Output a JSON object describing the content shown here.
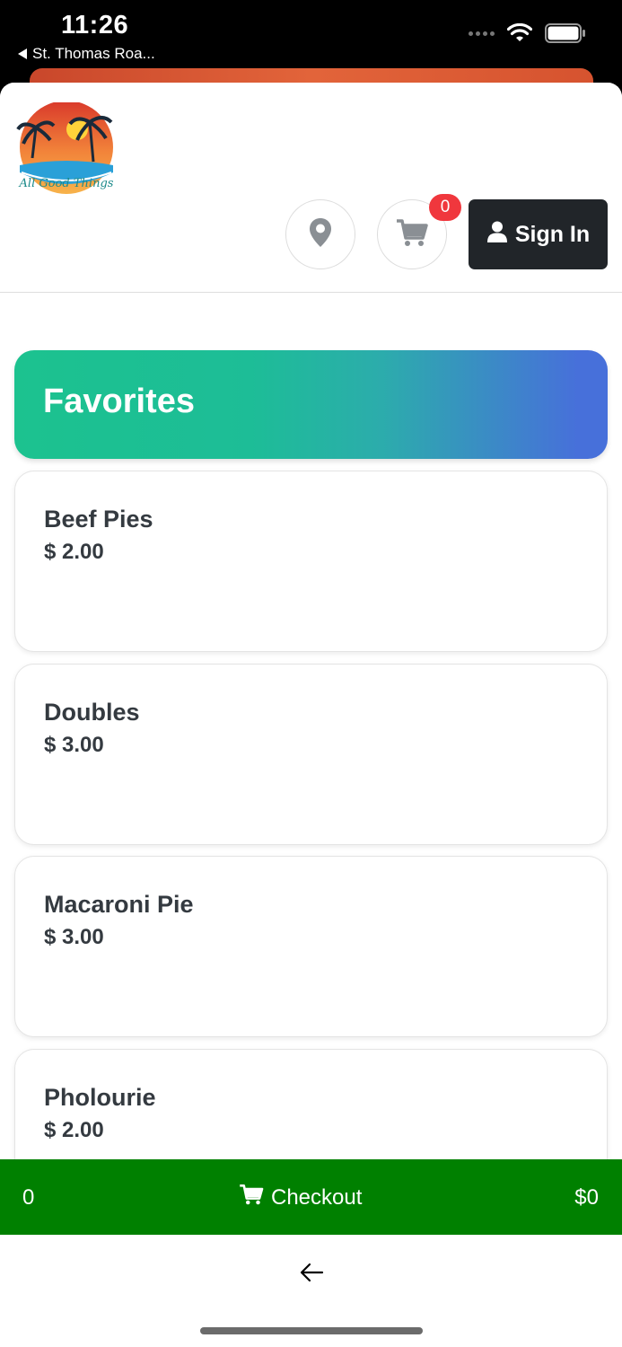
{
  "status_bar": {
    "time": "11:26",
    "back_label": "St. Thomas Roa..."
  },
  "header": {
    "logo_text": "All Good Things",
    "cart_count": "0",
    "sign_in_label": "Sign In"
  },
  "section": {
    "title": "Favorites"
  },
  "items": [
    {
      "name": "Beef Pies",
      "price": "$ 2.00"
    },
    {
      "name": "Doubles",
      "price": "$ 3.00"
    },
    {
      "name": "Macaroni Pie",
      "price": "$ 3.00"
    },
    {
      "name": "Pholourie",
      "price": "$ 2.00"
    }
  ],
  "checkout": {
    "count": "0",
    "label": "Checkout",
    "total": "$0"
  },
  "colors": {
    "checkout_green": "#008000",
    "badge_red": "#f0373d",
    "signin_dark": "#212529",
    "banner_start": "#1cc28f",
    "banner_end": "#4770da"
  },
  "icons": [
    "location-pin-icon",
    "cart-icon",
    "user-icon",
    "back-arrow-icon",
    "wifi-icon",
    "battery-icon"
  ]
}
